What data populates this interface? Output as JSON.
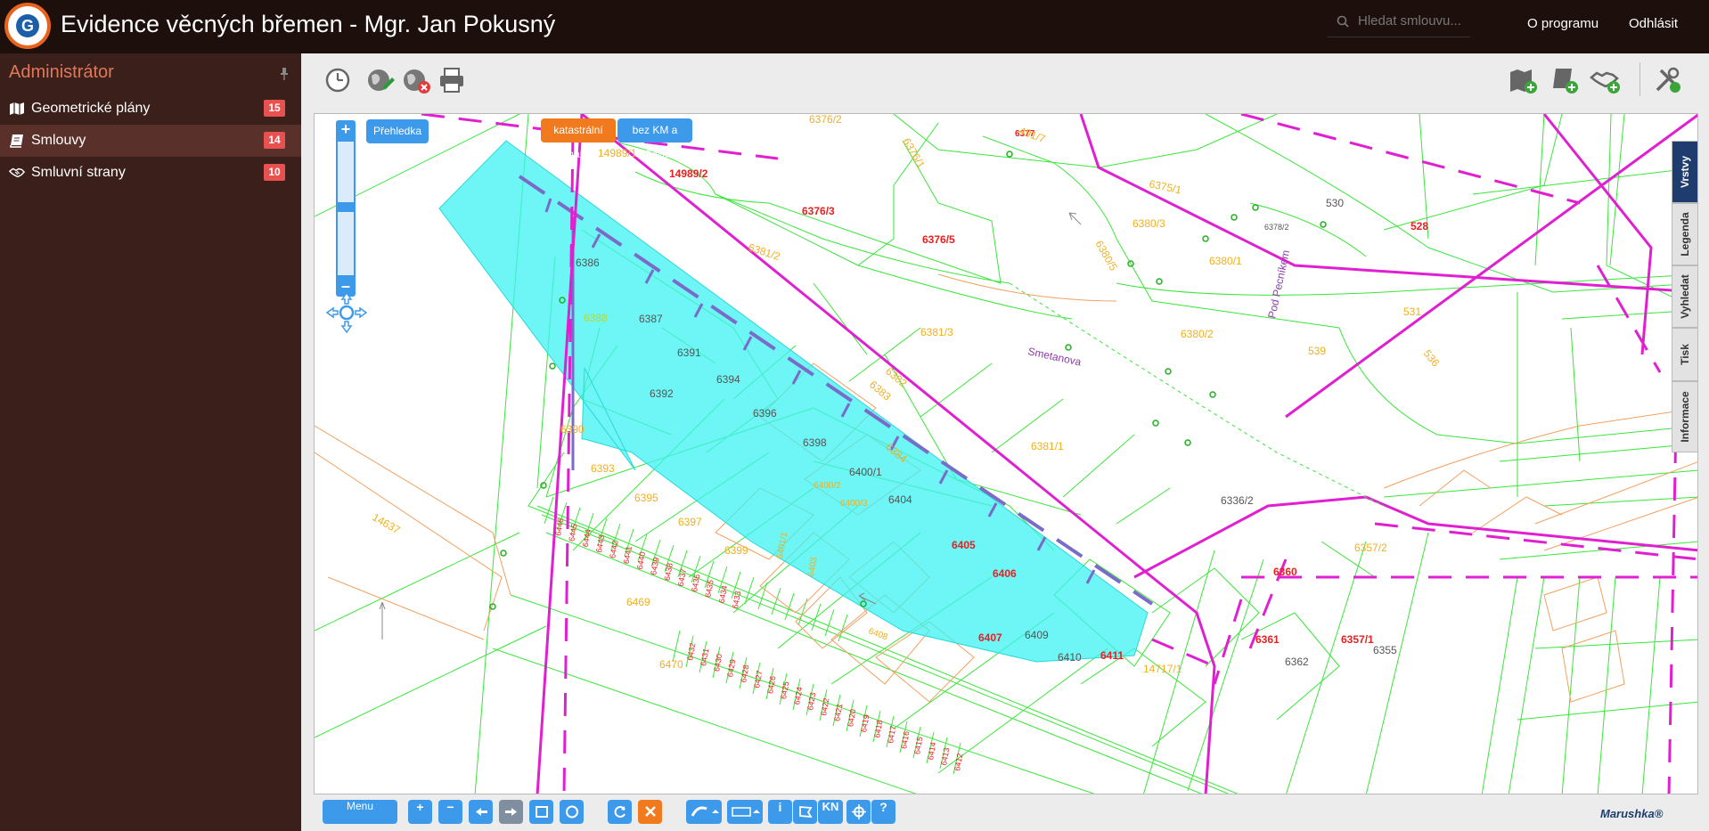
{
  "header": {
    "logo_letter": "G",
    "title": "Evidence věcných břemen - Mgr. Jan Pokusný",
    "search_placeholder": "Hledat smlouvu...",
    "links": [
      "O programu",
      "Odhlásit"
    ]
  },
  "sidebar": {
    "heading": "Administrátor",
    "items": [
      {
        "label": "Geometrické plány",
        "count": "15",
        "icon": "map-icon"
      },
      {
        "label": "Smlouvy",
        "count": "14",
        "icon": "book-icon",
        "active": true
      },
      {
        "label": "Smluvní strany",
        "count": "10",
        "icon": "handshake-icon"
      }
    ]
  },
  "map": {
    "overview_button": "Přehledka",
    "layer_buttons": [
      "katastrální mapa",
      "bez KM a DTMM"
    ],
    "side_tabs": [
      "Vrstvy",
      "Legenda",
      "Vyhledat",
      "Tisk",
      "Informace"
    ],
    "labels_red": [
      "14989/2",
      "6376/3",
      "6376/5",
      "6377",
      "528",
      "6360",
      "6361",
      "6357/1",
      "6405",
      "6406",
      "6407",
      "6411"
    ],
    "labels_orange": [
      "6376/2",
      "14989/1",
      "6381/2",
      "6380/3",
      "6380/1",
      "6380/2",
      "6381/3",
      "6381/1",
      "539",
      "531",
      "536",
      "6390",
      "6393",
      "6395",
      "6397",
      "6399",
      "6469",
      "6470",
      "6400/2",
      "6400/3",
      "6401/1",
      "6403",
      "6408",
      "14717/1",
      "14637",
      "6357/2",
      "6388",
      "6376/1",
      "6383",
      "6382",
      "6384",
      "6380/5",
      "6375/1",
      "491/7"
    ],
    "labels_gray": [
      "6386",
      "6387",
      "6391",
      "6392",
      "6394",
      "6396",
      "6398",
      "6400/1",
      "6404",
      "6409",
      "6410",
      "530",
      "6336/2",
      "6362",
      "6355",
      "6378/2"
    ],
    "street_names": [
      "Smetanova",
      "Pod Pecníkem"
    ],
    "lot_numbers": [
      "6446",
      "6445",
      "6444",
      "6443",
      "6442",
      "6441",
      "6440",
      "6439",
      "6438",
      "6437",
      "6436",
      "6435",
      "6434",
      "6433",
      "6432",
      "6431",
      "6430",
      "6429",
      "6428",
      "6427",
      "6426",
      "6425",
      "6424",
      "6423",
      "6422",
      "6421",
      "6420",
      "6419",
      "6418",
      "6417",
      "6416",
      "6415",
      "6414",
      "6413",
      "6412"
    ]
  },
  "bottom_toolbar": {
    "menu_label": "Menu",
    "brand": "Marushka®",
    "kn_label": "KN",
    "info_label": "i",
    "help_label": "?"
  },
  "colors": {
    "header_bg": "#1d0f0c",
    "sidebar_bg": "#3a1f1a",
    "accent_orange": "#f07a1d",
    "accent_blue": "#3d9aea",
    "badge_red": "#e8514f",
    "selection_cyan": "#3ef2f2",
    "utility_line_magenta": "#e020d0",
    "parcel_green": "#39e639"
  }
}
